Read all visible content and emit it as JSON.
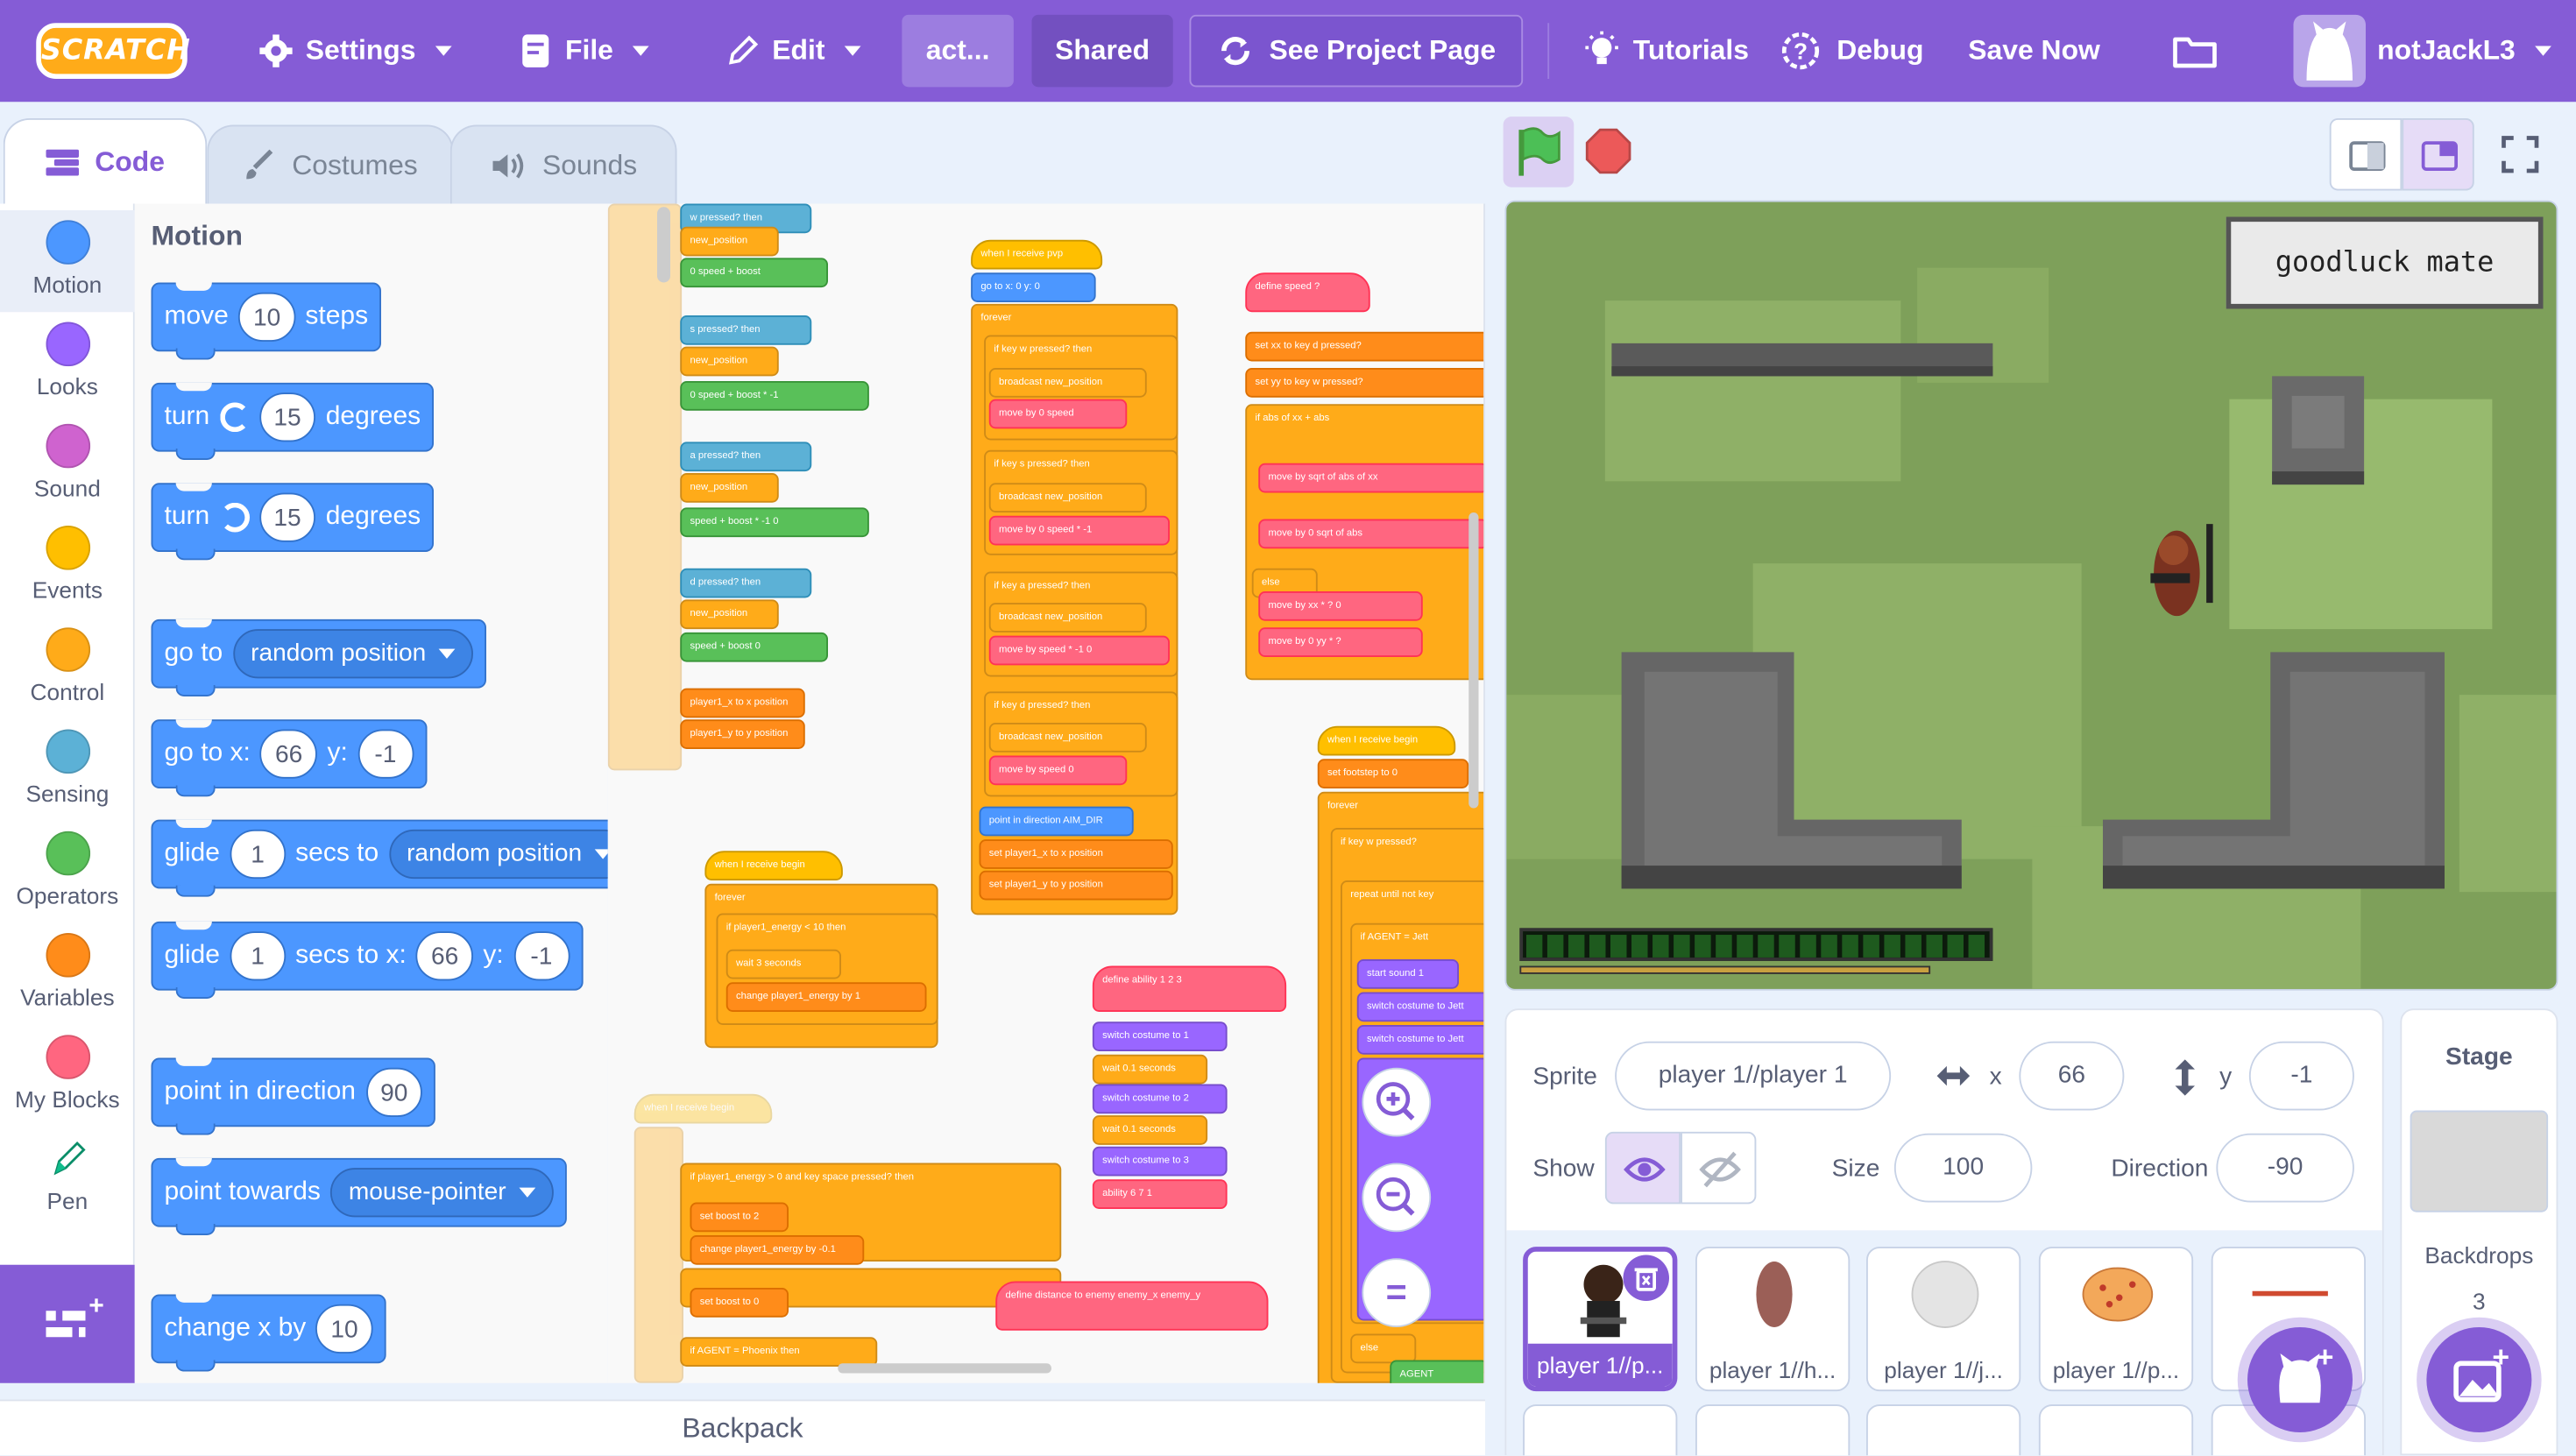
{
  "menubar": {
    "logo": "SCRATCH",
    "settings": "Settings",
    "file": "File",
    "edit": "Edit",
    "project_title": "act...",
    "shared": "Shared",
    "see_project_page": "See Project Page",
    "tutorials": "Tutorials",
    "debug": "Debug",
    "save_now": "Save Now",
    "username": "notJackL3"
  },
  "tabs": {
    "code": "Code",
    "costumes": "Costumes",
    "sounds": "Sounds"
  },
  "categories": [
    {
      "label": "Motion",
      "color": "#4c97ff"
    },
    {
      "label": "Looks",
      "color": "#9966ff"
    },
    {
      "label": "Sound",
      "color": "#cf63cf"
    },
    {
      "label": "Events",
      "color": "#ffbf00"
    },
    {
      "label": "Control",
      "color": "#ffab19"
    },
    {
      "label": "Sensing",
      "color": "#5cb1d6"
    },
    {
      "label": "Operators",
      "color": "#59c059"
    },
    {
      "label": "Variables",
      "color": "#ff8c1a"
    },
    {
      "label": "My Blocks",
      "color": "#ff6680"
    },
    {
      "label": "Pen",
      "color": "#0fbd8c"
    }
  ],
  "palette": {
    "title": "Motion",
    "move": {
      "a": "move",
      "steps": "10",
      "b": "steps"
    },
    "turn_right": {
      "a": "turn",
      "deg": "15",
      "b": "degrees"
    },
    "turn_left": {
      "a": "turn",
      "deg": "15",
      "b": "degrees"
    },
    "goto": {
      "a": "go to",
      "target": "random position"
    },
    "gotoxy": {
      "a": "go to x:",
      "x": "66",
      "yl": "y:",
      "y": "-1"
    },
    "glide": {
      "a": "glide",
      "secs": "1",
      "b": "secs to",
      "target": "random position"
    },
    "glidexy": {
      "a": "glide",
      "secs": "1",
      "b": "secs to x:",
      "x": "66",
      "yl": "y:",
      "y": "-1"
    },
    "point_dir": {
      "a": "point in direction",
      "dir": "90"
    },
    "point_towards": {
      "a": "point towards",
      "target": "mouse-pointer"
    },
    "change_x": {
      "a": "change x by",
      "val": "10"
    }
  },
  "scripts": {
    "pvp": "when I receive  pvp",
    "goto00": "go to x: 0  y: 0",
    "forever": "forever",
    "if_w": "if  key w pressed?  then",
    "bcast_np": "broadcast  new_position",
    "moveby_speed": "move by  0  speed",
    "if_s": "if  key s pressed?  then",
    "moveby_neg": "move by  0  speed * -1",
    "if_a": "if  key a pressed?  then",
    "moveby_a": "move by  speed * -1  0",
    "if_d": "if  key d pressed?  then",
    "moveby_d": "move by  speed  0",
    "pointdir": "point in direction  AIM_DIR",
    "setx": "set  player1_x  to  x position",
    "sety": "set  player1_y  to  y position",
    "define_speed": "define  speed  ?",
    "set_xx": "set  xx  to  key d pressed?",
    "set_yy": "set  yy  to  key w pressed?",
    "if_abs": "if  abs of xx + abs",
    "moveby_sqrt": "move by  sqrt of abs of xx",
    "moveby_sqrt2": "move by  0  sqrt of abs",
    "else": "else",
    "moveby_xx": "move by  xx * ?  0",
    "moveby_yy": "move by  0  yy * ?",
    "begin1": "when I receive  begin",
    "if_energy": "if  player1_energy < 10  then",
    "wait3": "wait  3  seconds",
    "change_energy": "change  player1_energy  by  1",
    "define_ability": "define  ability  1  2  3",
    "sw1": "switch costume to  1",
    "wait01": "wait  0.1  seconds",
    "sw2": "switch costume to  2",
    "wait01b": "wait  0.1  seconds",
    "sw3": "switch costume to  3",
    "ability": "ability  6  7  1",
    "begin2": "when I receive  begin",
    "set_footstep": "set  footstep  to  0",
    "forever2": "forever",
    "if_w2": "if  key w pressed?",
    "repeat_until": "repeat until  not  key",
    "if_agent": "if  AGENT  =  Jett",
    "start_sound": "start sound  1",
    "sw_jett": "switch costume to  Jett",
    "sw_jett2": "switch costume to  Jett",
    "begin3": "when I receive  begin",
    "if_energy2": "if  player1_energy > 0  and  key space pressed?  then",
    "set_boost": "set  boost  to  2",
    "change_energy2": "change  player1_energy  by  -0.1",
    "set_boost0": "set  boost  to  0",
    "if_phoenix": "if  AGENT  =  Phoenix  then",
    "define_dist": "define  distance to enemy  enemy_x  enemy_y",
    "top_pressed": "w  pressed?  then",
    "new_position": "new_position",
    "speed_boost": "0  speed + boost",
    "s_pressed": "s  pressed?  then",
    "new_position2": "new_position",
    "speed_boost2": "0  speed + boost * -1",
    "a_pressed": "a  pressed?  then",
    "new_position3": "new_position",
    "speed_boost3": "speed + boost * -1  0",
    "d_pressed": "d  pressed?  then",
    "new_position4": "new_position",
    "speed_boost4": "speed + boost  0",
    "xpos": "player1_x  to  x position",
    "ypos": "player1_y  to  y position",
    "agent_jett": "AGENT",
    "else2": "else",
    "agent2": "AGENT"
  },
  "stage": {
    "sign": "goodluck mate"
  },
  "sprite_info": {
    "sprite_label": "Sprite",
    "sprite_name": "player 1//player 1",
    "x_label": "x",
    "x": "66",
    "y_label": "y",
    "y": "-1",
    "show_label": "Show",
    "size_label": "Size",
    "size": "100",
    "direction_label": "Direction",
    "direction": "-90"
  },
  "sprites": [
    {
      "name": "player 1//p..."
    },
    {
      "name": "player 1//h..."
    },
    {
      "name": "player 1//j..."
    },
    {
      "name": "player 1//p..."
    },
    {
      "name": "pla..."
    }
  ],
  "stage_panel": {
    "title": "Stage",
    "backdrops_label": "Backdrops",
    "backdrops_count": "3"
  },
  "backpack": "Backpack",
  "zoom": {
    "equals": "="
  }
}
